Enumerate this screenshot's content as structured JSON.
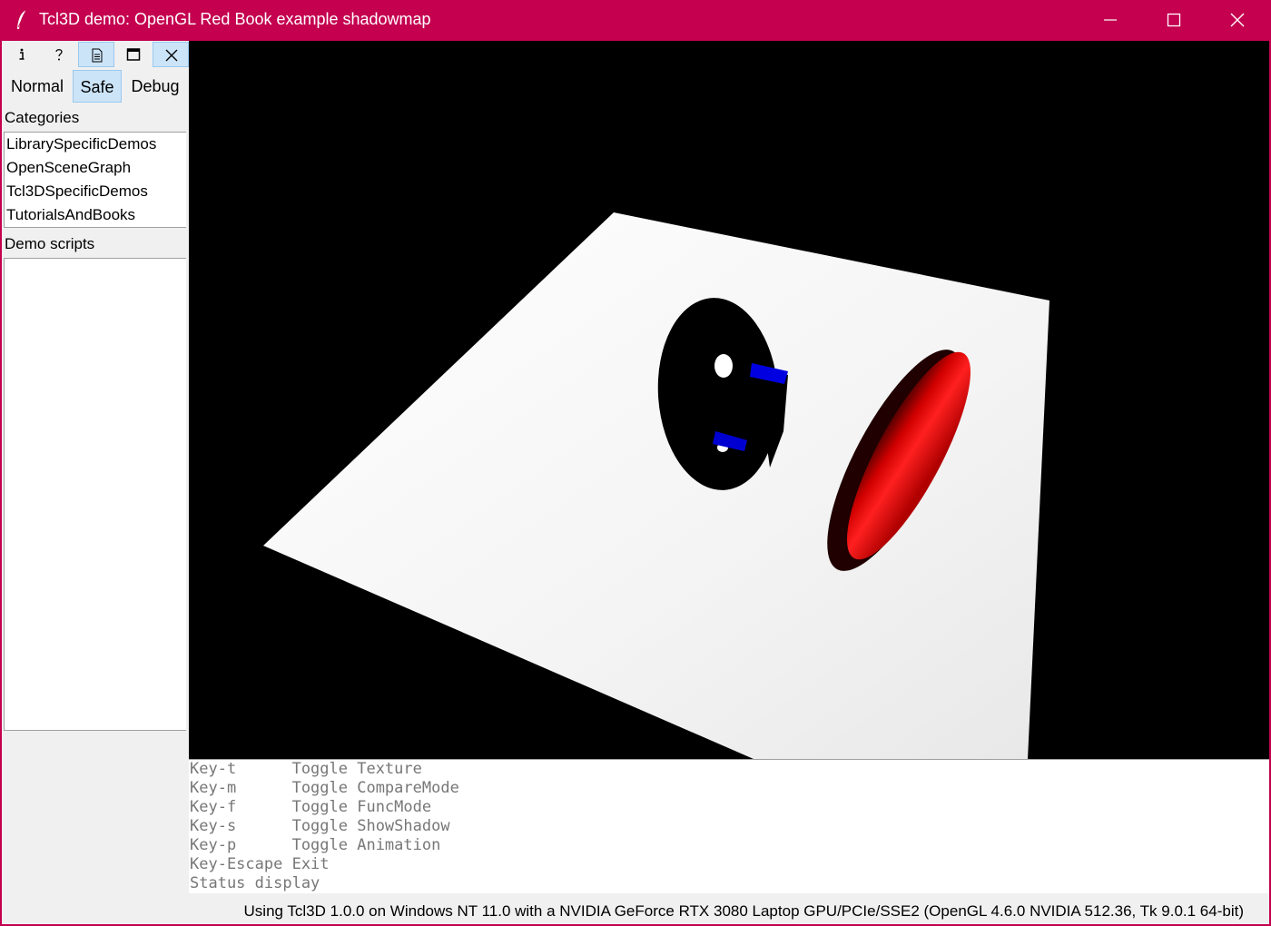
{
  "window": {
    "title": "Tcl3D demo: OpenGL Red Book example shadowmap",
    "icons": [
      "feather-icon",
      "minimize-icon",
      "maximize-icon",
      "close-icon"
    ]
  },
  "toolbar": {
    "buttons": [
      {
        "name": "info-icon",
        "pressed": false
      },
      {
        "name": "help-icon",
        "pressed": false
      },
      {
        "name": "source-icon",
        "pressed": true
      },
      {
        "name": "fullscreen-icon",
        "pressed": false
      },
      {
        "name": "exit-icon",
        "pressed": true
      }
    ]
  },
  "modes": {
    "normal": "Normal",
    "safe": "Safe",
    "debug": "Debug",
    "selected": "Safe"
  },
  "sidebar": {
    "categories_label": "Categories",
    "categories": [
      "LibrarySpecificDemos",
      "OpenSceneGraph",
      "Tcl3DSpecificDemos",
      "TutorialsAndBooks"
    ],
    "scripts_label": "Demo scripts",
    "scripts": []
  },
  "console": {
    "lines": [
      "Key-t      Toggle Texture",
      "Key-m      Toggle CompareMode",
      "Key-f      Toggle FuncMode",
      "Key-s      Toggle ShowShadow",
      "Key-p      Toggle Animation",
      "Key-Escape Exit",
      "Status display"
    ]
  },
  "status": {
    "text": "Using Tcl3D 1.0.0 on Windows NT 11.0 with a NVIDIA GeForce RTX 3080 Laptop GPU/PCIe/SSE2 (OpenGL 4.6.0 NVIDIA 512.36, Tk 9.0.1 64-bit)"
  },
  "colors": {
    "titlebar": "#c4004f",
    "background": "#000000",
    "plane": "#ffffff",
    "torus": "#ff0000",
    "cylinder": "#0000ff"
  }
}
